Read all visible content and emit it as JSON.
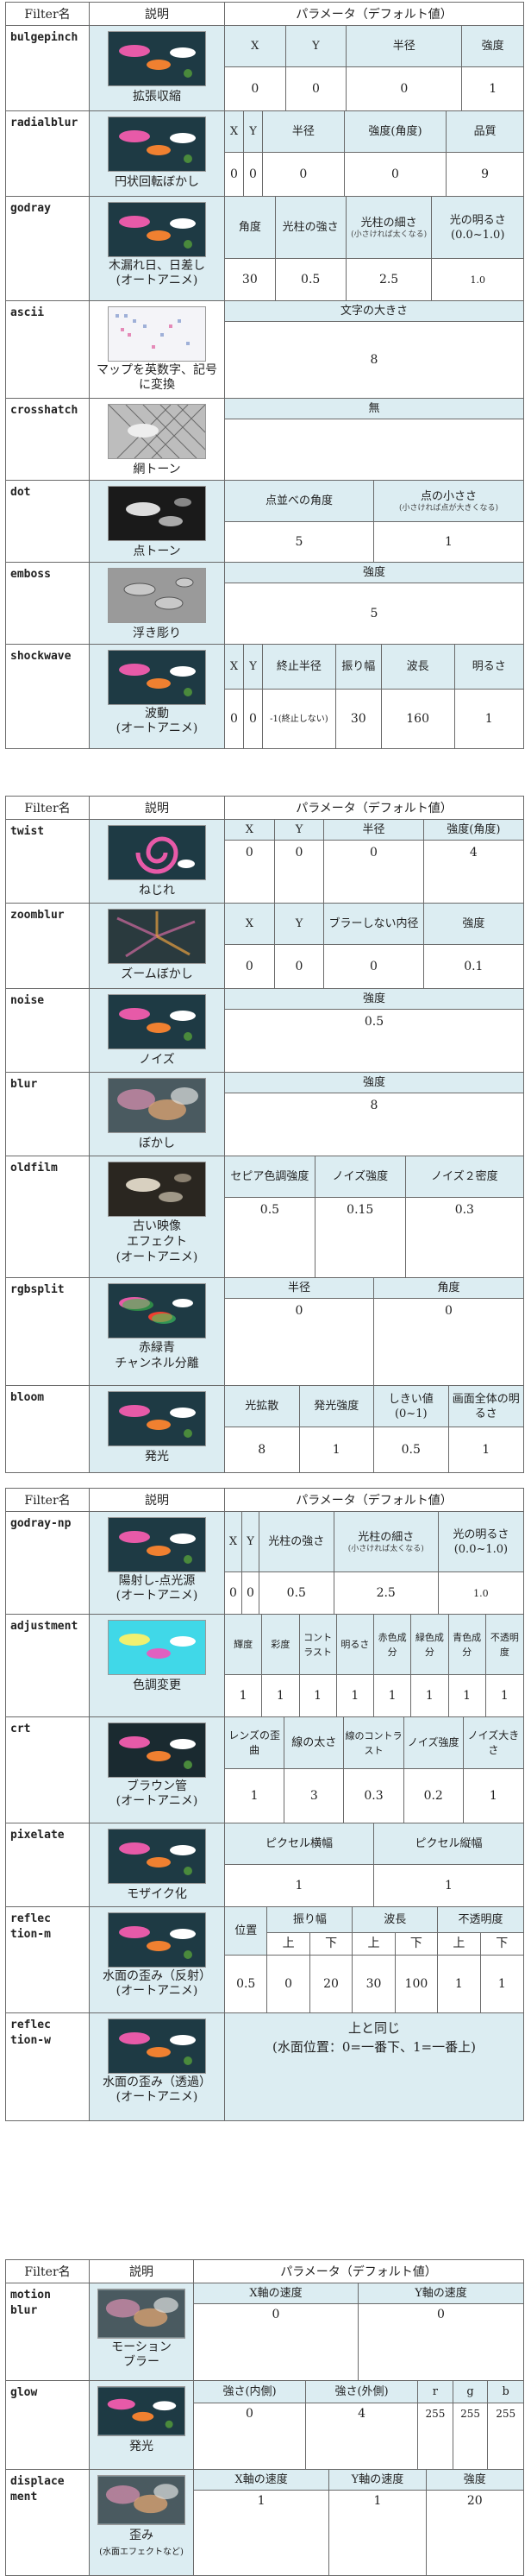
{
  "headers": {
    "filter": "Filter名",
    "desc": "説明",
    "param": "パラメータ（デフォルト値）"
  },
  "colors": {
    "accent_bg": "#dcedf2",
    "border": "#6a6a6a"
  },
  "tables": [
    {
      "filters": [
        {
          "name": "bulgepinch",
          "desc": "拡張収縮",
          "thumb": "koi",
          "labels": [
            "X",
            "Y",
            "半径",
            "強度"
          ],
          "values": [
            "0",
            "0",
            "0",
            "1"
          ]
        },
        {
          "name": "radialblur",
          "desc": "円状回転ぼかし",
          "thumb": "koi",
          "labels": [
            "X",
            "Y",
            "半径",
            "強度(角度)",
            "品質"
          ],
          "values": [
            "0",
            "0",
            "0",
            "0",
            "9"
          ]
        },
        {
          "name": "godray",
          "desc": "木漏れ日、日差し\n(オートアニメ)",
          "thumb": "koi",
          "labels": [
            "角度",
            "光柱の強さ",
            "光柱の細さ",
            "光の明るさ(0.0~1.0)"
          ],
          "label_notes": [
            "",
            "",
            "(小さければ太くなる)",
            ""
          ],
          "values": [
            "30",
            "0.5",
            "2.5",
            "1.0"
          ]
        },
        {
          "name": "ascii",
          "desc": "マップを英数字、記号に変換",
          "thumb": "ascii",
          "labels": [
            "文字の大きさ"
          ],
          "values": [
            "8"
          ]
        },
        {
          "name": "crosshatch",
          "desc": "網トーン",
          "thumb": "gray",
          "labels": [
            "無"
          ],
          "values": [
            ""
          ]
        },
        {
          "name": "dot",
          "desc": "点トーン",
          "thumb": "dot",
          "labels": [
            "点並べの角度",
            "点の小ささ"
          ],
          "label_notes": [
            "",
            "(小さければ点が大きくなる)"
          ],
          "values": [
            "5",
            "1"
          ]
        },
        {
          "name": "emboss",
          "desc": "浮き彫り",
          "thumb": "emboss",
          "labels": [
            "強度"
          ],
          "values": [
            "5"
          ]
        },
        {
          "name": "shockwave",
          "desc": "波動\n(オートアニメ)",
          "thumb": "koi",
          "labels": [
            "X",
            "Y",
            "終止半径",
            "振り幅",
            "波長",
            "明るさ"
          ],
          "values": [
            "0",
            "0",
            "-1(終止しない)",
            "30",
            "160",
            "1"
          ]
        }
      ]
    },
    {
      "filters": [
        {
          "name": "twist",
          "desc": "ねじれ",
          "thumb": "twist",
          "labels": [
            "X",
            "Y",
            "半径",
            "強度(角度)"
          ],
          "values": [
            "0",
            "0",
            "0",
            "4"
          ]
        },
        {
          "name": "zoomblur",
          "desc": "ズームぼかし",
          "thumb": "zoom",
          "labels": [
            "X",
            "Y",
            "ブラーしない内径",
            "強度"
          ],
          "values": [
            "0",
            "0",
            "0",
            "0.1"
          ]
        },
        {
          "name": "noise",
          "desc": "ノイズ",
          "thumb": "koi",
          "labels": [
            "強度"
          ],
          "values": [
            "0.5"
          ]
        },
        {
          "name": "blur",
          "desc": "ぼかし",
          "thumb": "blur",
          "labels": [
            "強度"
          ],
          "values": [
            "8"
          ]
        },
        {
          "name": "oldfilm",
          "desc": "古い映像\nエフェクト\n(オートアニメ)",
          "thumb": "dot",
          "labels": [
            "セピア色調強度",
            "ノイズ強度",
            "ノイズ２密度"
          ],
          "values": [
            "0.5",
            "0.15",
            "0.3"
          ]
        },
        {
          "name": "rgbsplit",
          "desc": "赤緑青\nチャンネル分離",
          "thumb": "rgb",
          "labels": [
            "半径",
            "角度"
          ],
          "values": [
            "0",
            "0"
          ]
        },
        {
          "name": "bloom",
          "desc": "発光",
          "thumb": "koi",
          "labels": [
            "光拡散",
            "発光強度",
            "しきい値(0~1)",
            "画面全体の明るさ"
          ],
          "values": [
            "8",
            "1",
            "0.5",
            "1"
          ]
        }
      ]
    },
    {
      "filters": [
        {
          "name": "godray-np",
          "desc": "陽射し-点光源\n(オートアニメ)",
          "thumb": "koi",
          "labels": [
            "X",
            "Y",
            "光柱の強さ",
            "光柱の細さ",
            "光の明るさ(0.0~1.0)"
          ],
          "label_notes": [
            "",
            "",
            "",
            "(小さければ太くなる)",
            ""
          ],
          "values": [
            "0",
            "0",
            "0.5",
            "2.5",
            "1.0"
          ]
        },
        {
          "name": "adjustment",
          "desc": "色調変更",
          "thumb": "cyan",
          "labels": [
            "輝度",
            "彩度",
            "コントラスト",
            "明るさ",
            "赤色成分",
            "緑色成分",
            "青色成分",
            "不透明度"
          ],
          "values": [
            "1",
            "1",
            "1",
            "1",
            "1",
            "1",
            "1",
            "1"
          ]
        },
        {
          "name": "crt",
          "desc": "ブラウン管\n(オートアニメ)",
          "thumb": "koi",
          "labels": [
            "レンズの歪曲",
            "線の太さ",
            "線のコントラスト",
            "ノイズ強度",
            "ノイズ大きさ"
          ],
          "values": [
            "1",
            "3",
            "0.3",
            "0.2",
            "1"
          ]
        },
        {
          "name": "pixelate",
          "desc": "モザイク化",
          "thumb": "koi",
          "labels": [
            "ピクセル横幅",
            "ピクセル縦幅"
          ],
          "values": [
            "1",
            "1"
          ]
        },
        {
          "name": "reflec\ntion-m",
          "desc": "水面の歪み（反射）\n(オートアニメ)",
          "thumb": "koi",
          "groups": [
            "位置",
            "振り幅",
            "波長",
            "不透明度"
          ],
          "sub": [
            "上",
            "下",
            "上",
            "下",
            "上",
            "下"
          ],
          "values": [
            "0.5",
            "0",
            "20",
            "30",
            "100",
            "1",
            "1"
          ]
        },
        {
          "name": "reflec\ntion-w",
          "desc": "水面の歪み（透過）\n(オートアニメ)",
          "thumb": "koi",
          "note_line1": "上と同じ",
          "note_line2": "(水面位置：0=一番下、1=一番上)"
        }
      ]
    },
    {
      "filters": [
        {
          "name": "motion\nblur",
          "desc": "モーション\nブラー",
          "thumb": "blur",
          "labels": [
            "X軸の速度",
            "Y軸の速度"
          ],
          "values": [
            "0",
            "0"
          ]
        },
        {
          "name": "glow",
          "desc": "発光",
          "thumb": "koi",
          "labels": [
            "強さ(内側)",
            "強さ(外側)",
            "r",
            "g",
            "b"
          ],
          "values": [
            "0",
            "4",
            "255",
            "255",
            "255"
          ]
        },
        {
          "name": "displace\nment",
          "desc": "歪み",
          "desc_note": "(水面エフェクトなど)",
          "thumb": "blur",
          "labels": [
            "X軸の速度",
            "Y軸の速度",
            "強度"
          ],
          "values": [
            "1",
            "1",
            "20"
          ]
        }
      ]
    }
  ]
}
